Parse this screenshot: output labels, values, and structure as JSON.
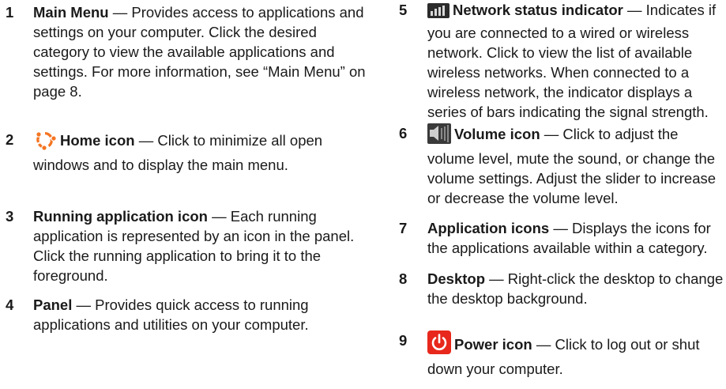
{
  "items": [
    {
      "number": "1",
      "term": "Main Menu",
      "dash": " — ",
      "description": "Provides access to applications and settings on your computer. Click the desired category to view the available applications and settings. For more information, see “Main Menu” on page 8."
    },
    {
      "number": "2",
      "icon": "home-icon",
      "term": "Home icon",
      "dash": " — ",
      "description": "Click to minimize all open windows and to display the main menu."
    },
    {
      "number": "3",
      "term": "Running application icon",
      "dash": " — ",
      "description": "Each running application is represented by an icon in the panel. Click the running application to bring it to the foreground."
    },
    {
      "number": "4",
      "term": "Panel",
      "dash": " — ",
      "description": "Provides quick access to running applications and utilities on your computer."
    },
    {
      "number": "5",
      "icon": "network-status-icon",
      "term": "Network status indicator",
      "dash": " — ",
      "description": "Indicates if you are connected to a wired or wireless network. Click to view the list of available wireless networks. When connected to a wireless network, the indicator displays a series of bars indicating the signal strength."
    },
    {
      "number": "6",
      "icon": "volume-icon",
      "term": "Volume icon",
      "dash": " — ",
      "description": "Click to adjust the volume level, mute the sound, or change the volume settings. Adjust the slider to increase or decrease the volume level."
    },
    {
      "number": "7",
      "term": "Application icons",
      "dash": " — ",
      "description": "Displays the icons for the applications available within a category."
    },
    {
      "number": "8",
      "term": "Desktop",
      "dash": " — ",
      "description": "Right-click the desktop to change the desktop background."
    },
    {
      "number": "9",
      "icon": "power-icon",
      "term": "Power icon",
      "dash": " — ",
      "description": "Click to log out or shut down your computer."
    }
  ],
  "colors": {
    "text": "#1a1a1a",
    "home_icon_orange": "#f47421",
    "power_icon_red": "#e8281c"
  }
}
